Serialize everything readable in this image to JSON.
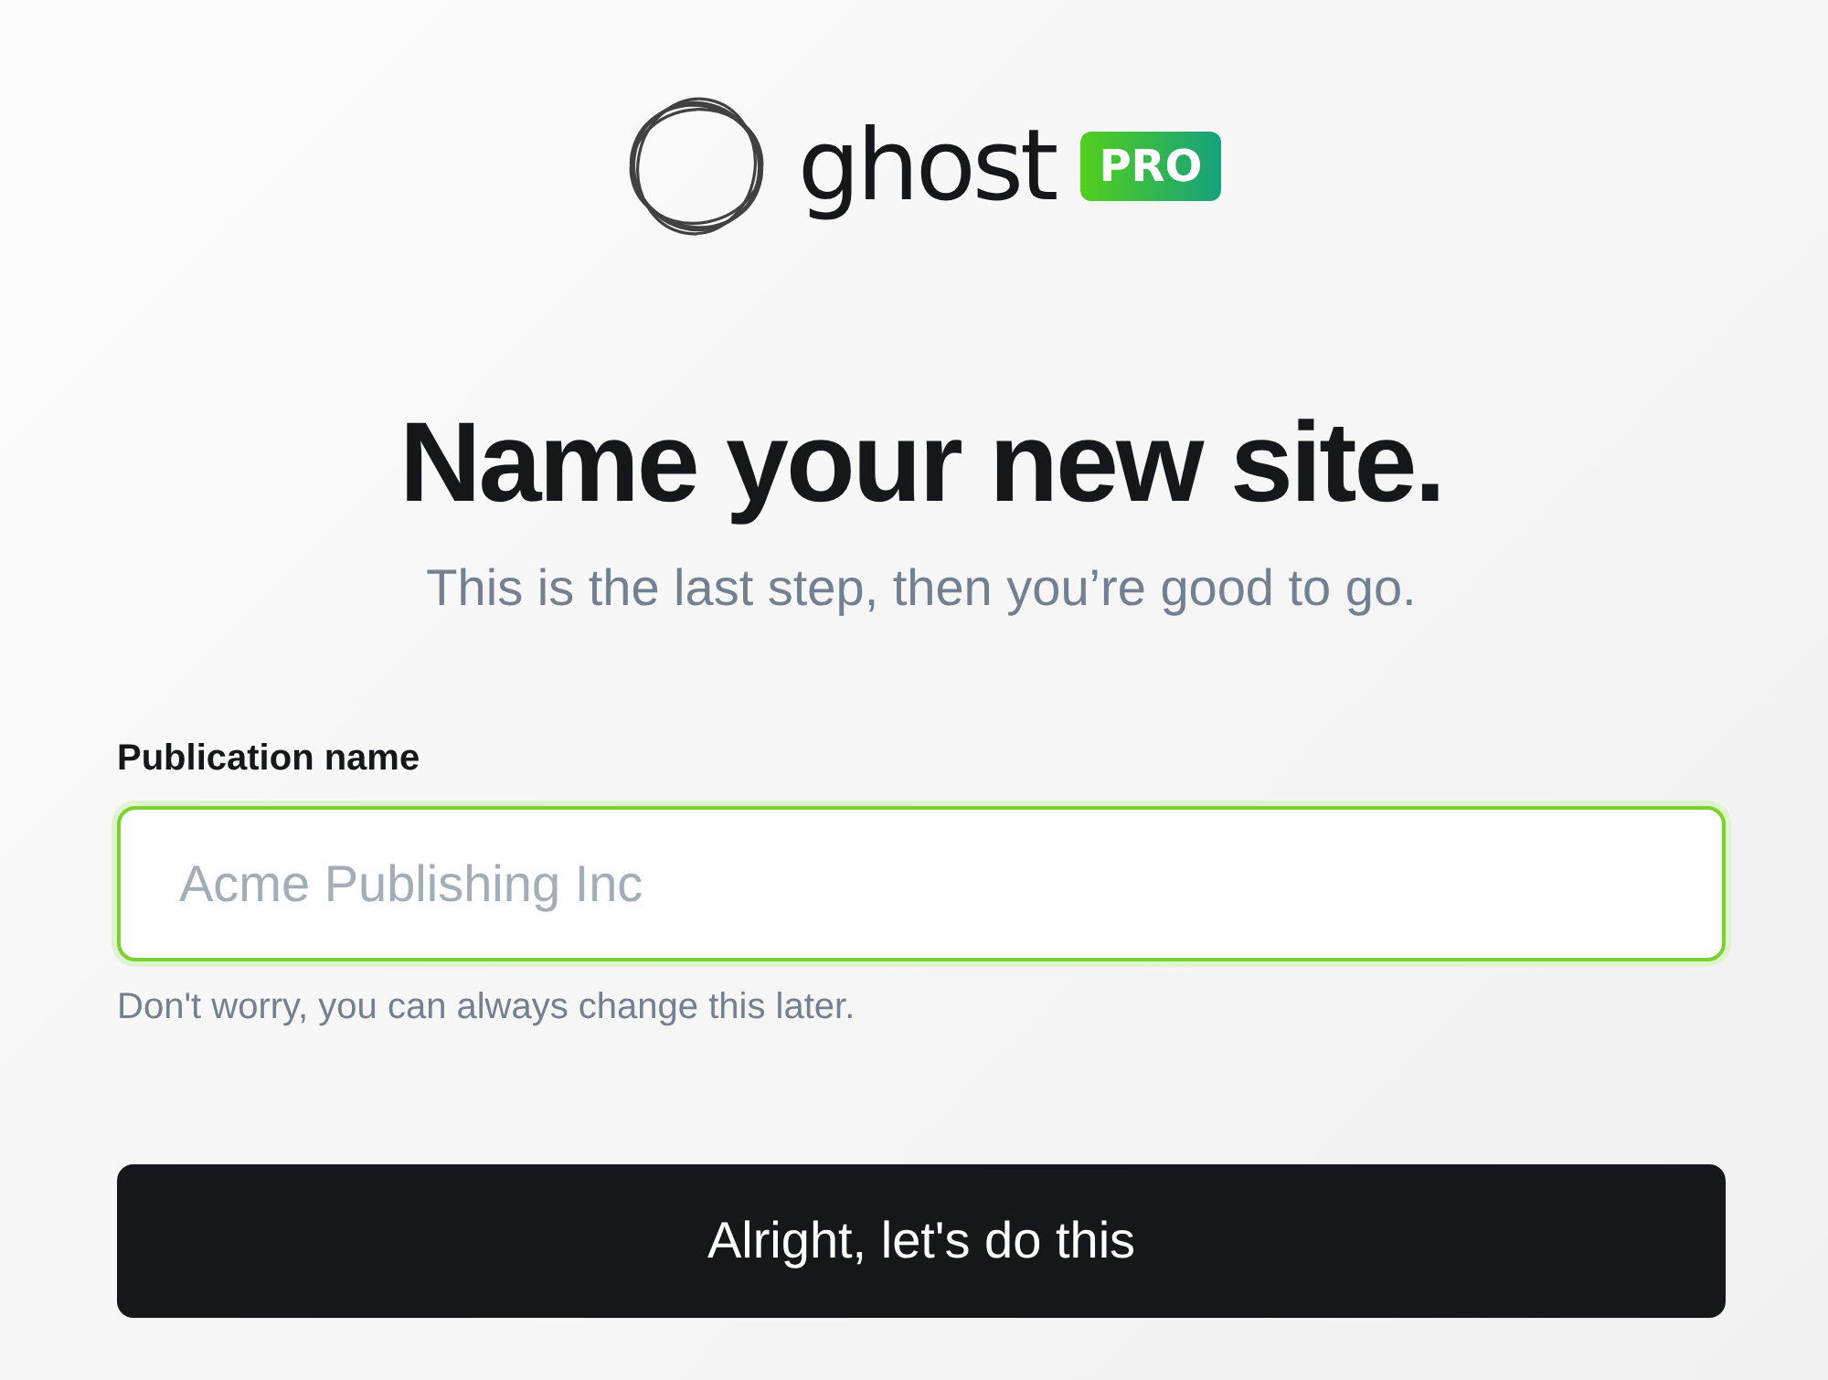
{
  "logo": {
    "wordmark": "ghost",
    "badge": "PRO"
  },
  "heading": "Name your new site.",
  "subtitle": "This is the last step, then you’re good to go.",
  "field": {
    "label": "Publication name",
    "placeholder": "Acme Publishing Inc",
    "focused": true,
    "hint": "Don't worry, you can always change this later."
  },
  "button": "Alright, let's do this"
}
